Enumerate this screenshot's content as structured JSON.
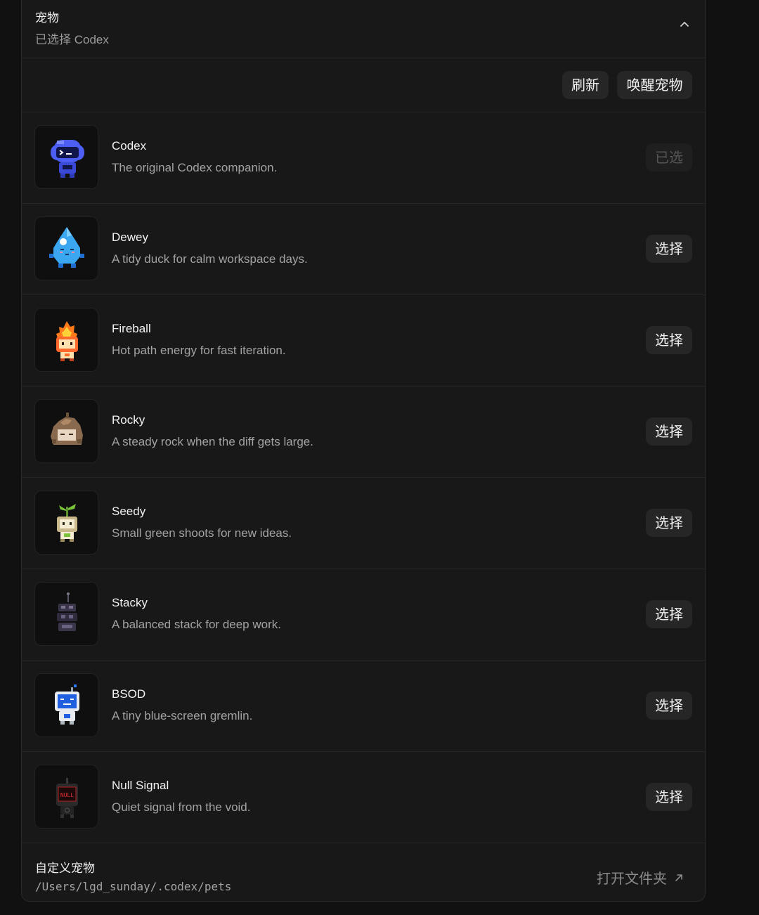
{
  "header": {
    "title": "宠物",
    "subtitle": "已选择 Codex"
  },
  "toolbar": {
    "refresh_label": "刷新",
    "wake_label": "唤醒宠物"
  },
  "pets": [
    {
      "name": "Codex",
      "desc": "The original Codex companion.",
      "action": "已选",
      "selected": true,
      "icon": "codex-cloud-robot"
    },
    {
      "name": "Dewey",
      "desc": "A tidy duck for calm workspace days.",
      "action": "选择",
      "selected": false,
      "icon": "water-drop"
    },
    {
      "name": "Fireball",
      "desc": "Hot path energy for fast iteration.",
      "action": "选择",
      "selected": false,
      "icon": "flame-robot"
    },
    {
      "name": "Rocky",
      "desc": "A steady rock when the diff gets large.",
      "action": "选择",
      "selected": false,
      "icon": "rock"
    },
    {
      "name": "Seedy",
      "desc": "Small green shoots for new ideas.",
      "action": "选择",
      "selected": false,
      "icon": "sprout-robot"
    },
    {
      "name": "Stacky",
      "desc": "A balanced stack for deep work.",
      "action": "选择",
      "selected": false,
      "icon": "stack-robot"
    },
    {
      "name": "BSOD",
      "desc": "A tiny blue-screen gremlin.",
      "action": "选择",
      "selected": false,
      "icon": "blue-screen-robot"
    },
    {
      "name": "Null Signal",
      "desc": "Quiet signal from the void.",
      "action": "选择",
      "selected": false,
      "icon": "null-robot",
      "icon_text": "NULL"
    }
  ],
  "footer": {
    "title": "自定义宠物",
    "path": "/Users/lgd_sunday/.codex/pets",
    "open_label": "打开文件夹"
  }
}
